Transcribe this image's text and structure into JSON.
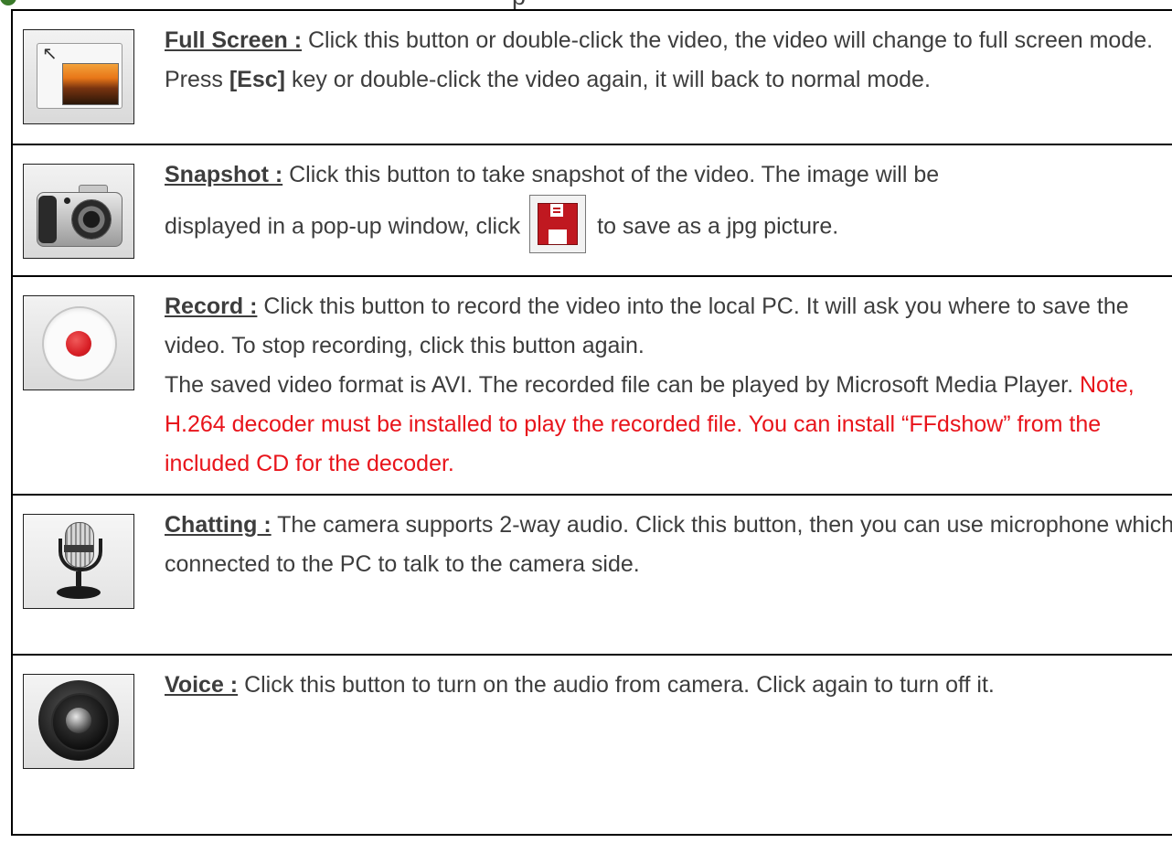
{
  "header_fragment": {
    "text": "p"
  },
  "rows": [
    {
      "id": "full-screen",
      "icon": "fullscreen-icon",
      "title": "Full Screen :",
      "text1": " Click this button or double-click the video, the video will change to full screen mode.",
      "text2_pre": "Press ",
      "text2_key": "[Esc]",
      "text2_post": " key or double-click the video again, it will back to normal mode."
    },
    {
      "id": "snapshot",
      "icon": "camera-icon",
      "title": "Snapshot :",
      "text1": " Click this button to take snapshot of the video. The image will be",
      "text2_pre": "displayed in a pop-up window, click",
      "inline_icon": "save-floppy-icon",
      "text2_post": "to save as a jpg picture."
    },
    {
      "id": "record",
      "icon": "record-icon",
      "title": "Record :",
      "text1": " Click this button to record the video into the local PC. It will ask you where to save the video. To stop recording, click this button again.",
      "text2": "The saved video format is AVI. The recorded file can be played by Microsoft Media Player. ",
      "note": "Note, H.264 decoder must be installed to play the recorded file. You can install “FFdshow” from the included CD for the decoder.",
      "note_color": "#e8141b"
    },
    {
      "id": "chatting",
      "icon": "microphone-icon",
      "title": "Chatting :",
      "text1": " The camera supports 2-way audio. Click this button, then you can use microphone which connected to the PC to talk to the camera side."
    },
    {
      "id": "voice",
      "icon": "speaker-icon",
      "title": "Voice :",
      "text1": " Click this button to turn on the audio from camera. Click again to turn off it."
    }
  ]
}
